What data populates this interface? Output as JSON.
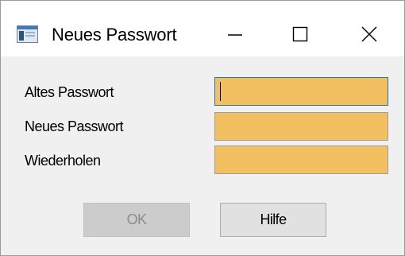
{
  "window": {
    "title": "Neues Passwort",
    "app_icon": "window-app-icon",
    "controls": {
      "minimize_icon": "minimize-icon",
      "maximize_icon": "maximize-icon",
      "close_icon": "close-icon"
    }
  },
  "form": {
    "fields": [
      {
        "label": "Altes Passwort",
        "value": "",
        "focused": true
      },
      {
        "label": "Neues Passwort",
        "value": "",
        "focused": false
      },
      {
        "label": "Wiederholen",
        "value": "",
        "focused": false
      }
    ],
    "field_color": "#f2c060"
  },
  "buttons": {
    "ok_label": "OK",
    "ok_enabled": false,
    "help_label": "Hilfe"
  }
}
